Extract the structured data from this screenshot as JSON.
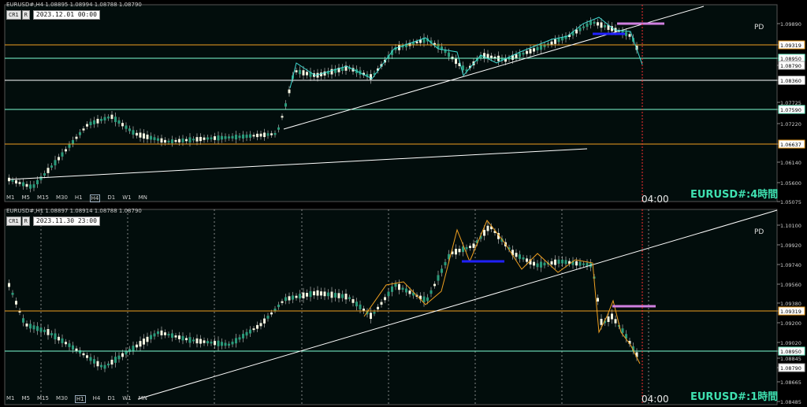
{
  "colors": {
    "bg": "#000000",
    "plot_bg": "#020d0c",
    "gold": "#f0a020",
    "aqua": "#7fffd4",
    "white": "#ffffff",
    "blue": "#2020ff",
    "pink": "#d080e0",
    "red": "#ff3030"
  },
  "top_panel": {
    "header": "EURUSD#,H4  1.08895 1.08994 1.08788 1.08790",
    "btn_cr": "CR1",
    "btn_r": "R",
    "date": "2023.12.01 00:00",
    "timeframes": [
      "M1",
      "M5",
      "M15",
      "M30",
      "H1",
      "H4",
      "D1",
      "W1",
      "MN"
    ],
    "active_tf": "H4",
    "pd": "PD",
    "symbol_label": "EURUSD#:4時間",
    "time_label": "04:00",
    "price_ticks": [
      "1.09890",
      "1.09319",
      "1.08950",
      "1.08790",
      "1.08360",
      "1.07725",
      "1.07590",
      "1.07220",
      "1.06637",
      "1.06140",
      "1.05600",
      "1.05075"
    ],
    "levels": [
      {
        "price": "1.09319",
        "color": "gold"
      },
      {
        "price": "1.08950",
        "color": "aqua"
      },
      {
        "price": "1.08360",
        "color": "white"
      },
      {
        "price": "1.07590",
        "color": "aqua"
      },
      {
        "price": "1.06637",
        "color": "gold"
      }
    ],
    "current": "1.08790"
  },
  "bottom_panel": {
    "header": "EURUSD#,H1  1.08897 1.08914 1.08788 1.08790",
    "btn_cr": "CR1",
    "btn_r": "R",
    "date": "2023.11.30 23:00",
    "timeframes": [
      "M1",
      "M5",
      "M15",
      "M30",
      "H1",
      "H4",
      "D1",
      "W1",
      "MN"
    ],
    "active_tf": "H1",
    "pd": "PD",
    "symbol_label": "EURUSD#:1時間",
    "time_label": "04:00",
    "price_ticks": [
      "1.10100",
      "1.09920",
      "1.09740",
      "1.09560",
      "1.09380",
      "1.09319",
      "1.09200",
      "1.09020",
      "1.08950",
      "1.08845",
      "1.08790",
      "1.08665",
      "1.08485"
    ],
    "levels": [
      {
        "price": "1.09319",
        "color": "gold"
      },
      {
        "price": "1.08950",
        "color": "aqua"
      }
    ],
    "current": "1.08790"
  }
}
